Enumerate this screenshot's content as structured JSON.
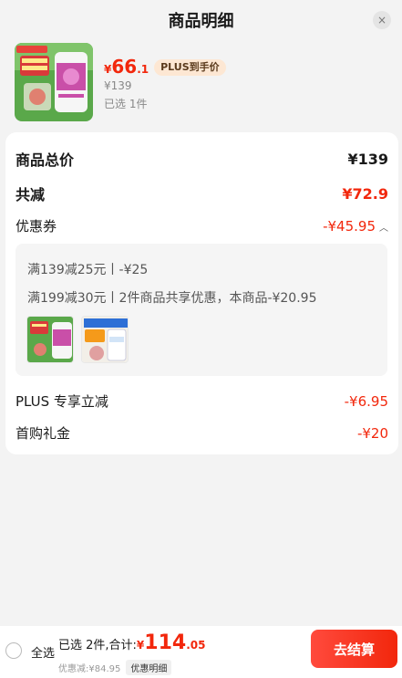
{
  "header": {
    "title": "商品明细",
    "close": "×"
  },
  "product": {
    "price_symbol": "¥",
    "price_int": "66",
    "price_dec": ".1",
    "plus_tag": "PLUS到手价",
    "original_price": "¥139",
    "quantity": "已选 1件",
    "image_icon": "supplement-bottle-product-image"
  },
  "summary": {
    "total_label": "商品总价",
    "total_value": "¥139",
    "reduce_label": "共减",
    "reduce_value": "¥72.9",
    "coupon_label": "优惠券",
    "coupon_value": "-¥45.95",
    "coupon_lines": [
      "满139减25元丨-¥25",
      "满199减30元丨2件商品共享优惠，本商品-¥20.95"
    ],
    "plus_label": "PLUS 专享立减",
    "plus_value": "-¥6.95",
    "first_label": "首购礼金",
    "first_value": "-¥20"
  },
  "bottom": {
    "select_all": "全选",
    "selected_text": "已选 2件,合计:",
    "total_symbol": "¥",
    "total_int": "114",
    "total_dec": ".05",
    "discount_text": "优惠减:¥84.95",
    "detail_label": "优惠明细",
    "checkout_label": "去结算"
  },
  "colors": {
    "accent": "#f2270c",
    "background": "#f3f3f3",
    "card": "#ffffff"
  }
}
